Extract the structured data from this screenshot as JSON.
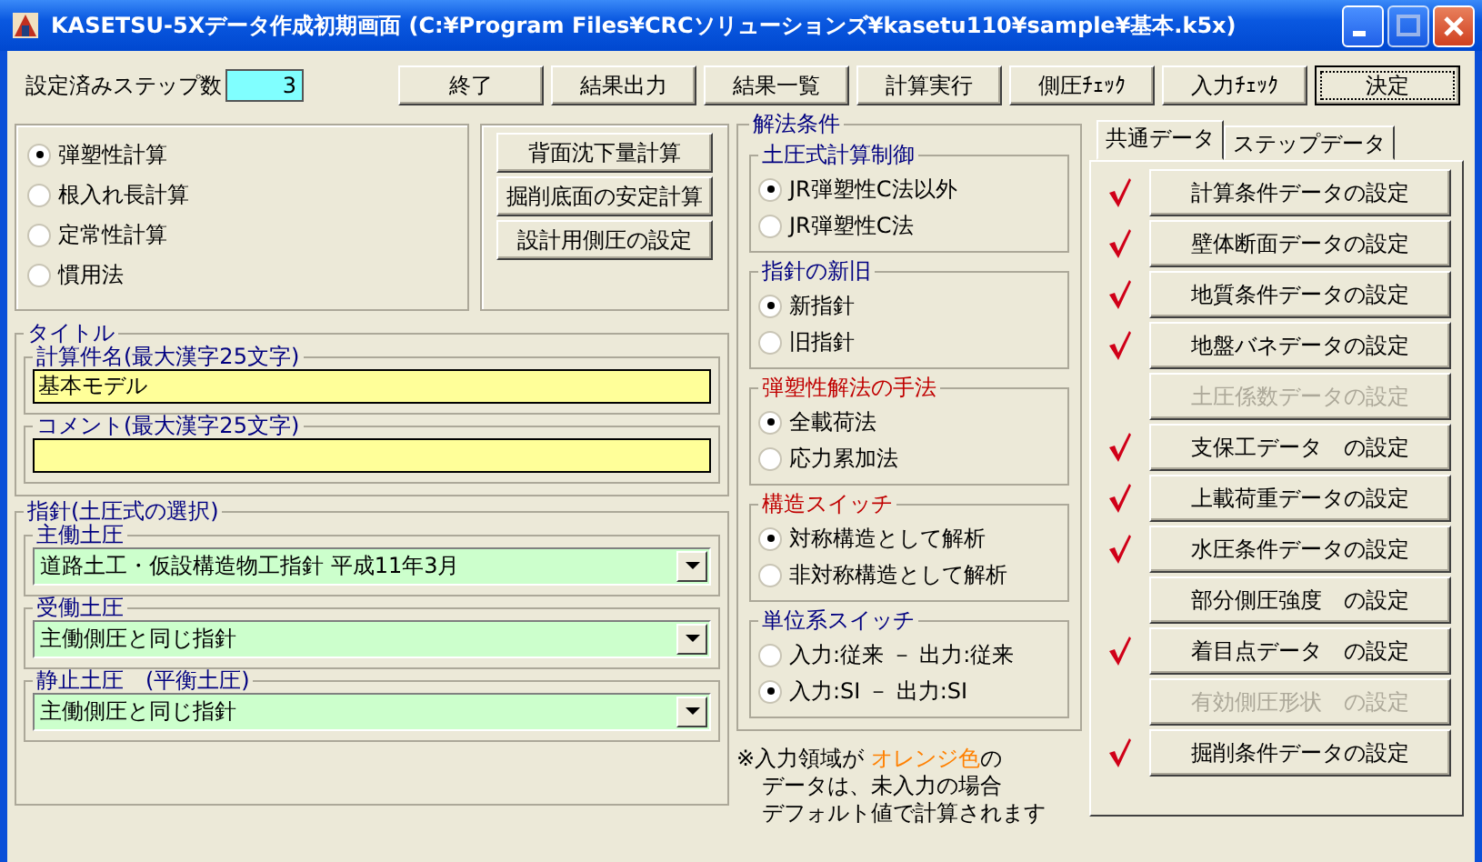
{
  "window": {
    "title": "KASETSU-5Xデータ作成初期画面 (C:¥Program Files¥CRCソリューションズ¥kasetu110¥sample¥基本.k5x)"
  },
  "step_count": {
    "label": "設定済みステップ数",
    "value": "3"
  },
  "toolbar": [
    {
      "label": "終了"
    },
    {
      "label": "結果出力"
    },
    {
      "label": "結果一覧"
    },
    {
      "label": "計算実行"
    },
    {
      "label": "側圧ﾁｪｯｸ"
    },
    {
      "label": "入力ﾁｪｯｸ"
    },
    {
      "label": "決定",
      "focused": true
    }
  ],
  "calc_types": [
    {
      "label": "弾塑性計算",
      "selected": true
    },
    {
      "label": "根入れ長計算",
      "selected": false
    },
    {
      "label": "定常性計算",
      "selected": false
    },
    {
      "label": "慣用法",
      "selected": false
    }
  ],
  "calc_buttons": [
    {
      "label": "背面沈下量計算"
    },
    {
      "label": "掘削底面の安定計算"
    },
    {
      "label": "設計用側圧の設定"
    }
  ],
  "title_group": {
    "label": "タイトル",
    "fields": [
      {
        "label": "計算件名(最大漢字25文字)",
        "value": "基本モデル"
      },
      {
        "label": "コメント(最大漢字25文字)"
      }
    ]
  },
  "guideline_group": {
    "label": "指針(土圧式の選択)",
    "combos": [
      {
        "label": "主働土圧",
        "value": "道路土工・仮設構造物工指針 平成11年3月"
      },
      {
        "label": "受働土圧",
        "value": "主働側圧と同じ指針"
      },
      {
        "label": "静止土圧　(平衡土圧)",
        "value": "主働側圧と同じ指針"
      }
    ]
  },
  "solution": {
    "label": "解法条件",
    "groups": [
      {
        "label": "土圧式計算制御",
        "color": "#000080",
        "options": [
          {
            "label": "JR弾塑性C法以外",
            "selected": true
          },
          {
            "label": "JR弾塑性C法",
            "selected": false
          }
        ]
      },
      {
        "label": "指針の新旧",
        "color": "#000080",
        "options": [
          {
            "label": "新指針",
            "selected": true
          },
          {
            "label": "旧指針",
            "selected": false
          }
        ]
      },
      {
        "label": "弾塑性解法の手法",
        "color": "#c00000",
        "options": [
          {
            "label": "全載荷法",
            "selected": true
          },
          {
            "label": "応力累加法",
            "selected": false
          }
        ]
      },
      {
        "label": "構造スイッチ",
        "color": "#c00000",
        "options": [
          {
            "label": "対称構造として解析",
            "selected": true
          },
          {
            "label": "非対称構造として解析",
            "selected": false
          }
        ]
      },
      {
        "label": "単位系スイッチ",
        "color": "#000080",
        "options": [
          {
            "label": "入力:従来 － 出力:従来",
            "selected": false
          },
          {
            "label": "入力:SI － 出力:SI",
            "selected": true
          }
        ]
      }
    ]
  },
  "note": [
    {
      "before": "※入力領域が ",
      "highlight": "オレンジ色",
      "after": "の"
    },
    {
      "text": "データは、未入力の場合"
    },
    {
      "text": "デフォルト値で計算されます"
    }
  ],
  "tabs": [
    {
      "label": "共通データ",
      "selected": true
    },
    {
      "label": "ステップデータ",
      "selected": false
    }
  ],
  "data_buttons": [
    {
      "label": "計算条件データの設定",
      "checked": true,
      "disabled": false
    },
    {
      "label": "壁体断面データの設定",
      "checked": true,
      "disabled": false
    },
    {
      "label": "地質条件データの設定",
      "checked": true,
      "disabled": false
    },
    {
      "label": "地盤バネデータの設定",
      "checked": true,
      "disabled": false
    },
    {
      "label": "土圧係数データの設定",
      "checked": false,
      "disabled": true
    },
    {
      "label": "支保工データ　の設定",
      "checked": true,
      "disabled": false
    },
    {
      "label": "上載荷重データの設定",
      "checked": true,
      "disabled": false
    },
    {
      "label": "水圧条件データの設定",
      "checked": true,
      "disabled": false
    },
    {
      "label": "部分側圧強度　の設定",
      "checked": false,
      "disabled": false
    },
    {
      "label": "着目点データ　の設定",
      "checked": true,
      "disabled": false
    },
    {
      "label": "有効側圧形状　の設定",
      "checked": false,
      "disabled": true
    },
    {
      "label": "掘削条件データの設定",
      "checked": true,
      "disabled": false
    }
  ]
}
